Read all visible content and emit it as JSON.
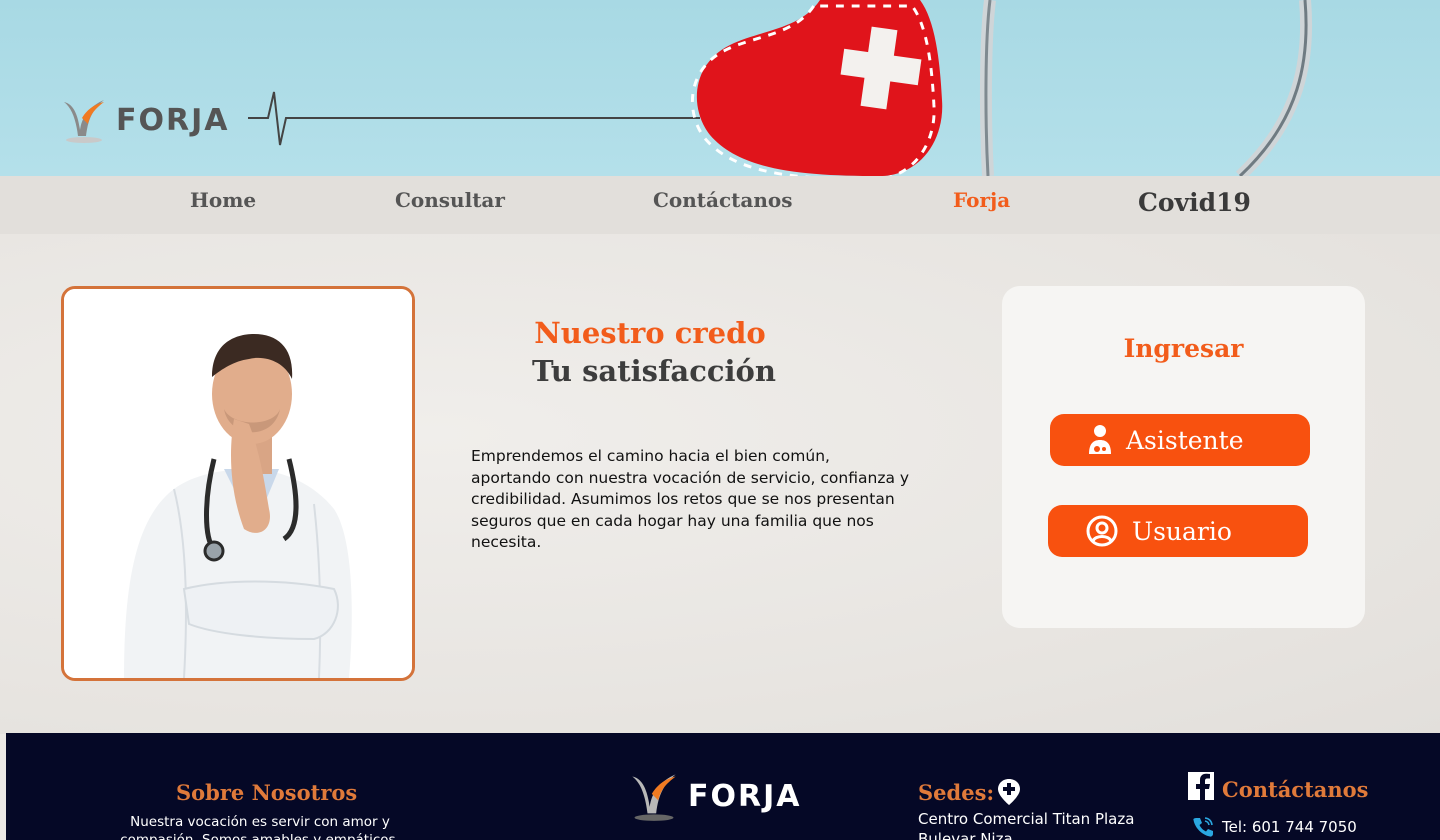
{
  "brand": {
    "name": "FORJA"
  },
  "nav": {
    "items": [
      {
        "label": "Home"
      },
      {
        "label": "Consultar"
      },
      {
        "label": "Contáctanos"
      },
      {
        "label": "Forja"
      },
      {
        "label": "Covid19"
      }
    ],
    "active": "Forja"
  },
  "hero": {
    "headline_accent": "Nuestro credo",
    "headline_main": "Tu satisfacción",
    "body": "Emprendemos el camino hacia el bien común, aportando con nuestra vocación de servicio, confianza y credibilidad. Asumimos los retos que se nos presentan seguros que en cada hogar hay una familia que nos necesita."
  },
  "login": {
    "title": "Ingresar",
    "buttons": [
      {
        "label": "Asistente",
        "icon": "doctor-icon"
      },
      {
        "label": "Usuario",
        "icon": "user-circle-icon"
      }
    ]
  },
  "footer": {
    "about": {
      "title": "Sobre Nosotros",
      "text": "Nuestra vocación es servir con amor y compasión. Somos amables y empáticos."
    },
    "sedes": {
      "title": "Sedes:",
      "text": "Centro Comercial Titan Plaza Bulevar Niza"
    },
    "contact": {
      "title": "Contáctanos",
      "phone": "Tel: 601 744 7050"
    }
  },
  "colors": {
    "accent": "#f25c1b",
    "button": "#f8510f",
    "footer_bg": "#050826",
    "footer_title": "#e07a3a",
    "hero_sky": "#a8d9e4"
  }
}
